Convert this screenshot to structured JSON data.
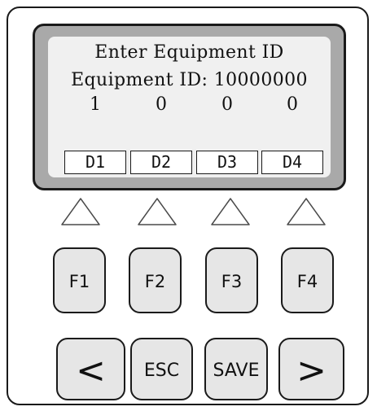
{
  "display": {
    "line1": "Enter Equipment ID",
    "line2": "Equipment ID: 10000000",
    "digits": [
      "1",
      "0",
      "0",
      "0"
    ],
    "softkeys": [
      "D1",
      "D2",
      "D3",
      "D4"
    ]
  },
  "function_keys": [
    "F1",
    "F2",
    "F3",
    "F4"
  ],
  "nav_keys": {
    "left": "<",
    "esc": "ESC",
    "save": "SAVE",
    "right": ">"
  },
  "colors": {
    "bezel": "#a9a9a9",
    "screen": "#f0f0f0",
    "key": "#e6e6e6",
    "outline": "#1a1a1a"
  }
}
